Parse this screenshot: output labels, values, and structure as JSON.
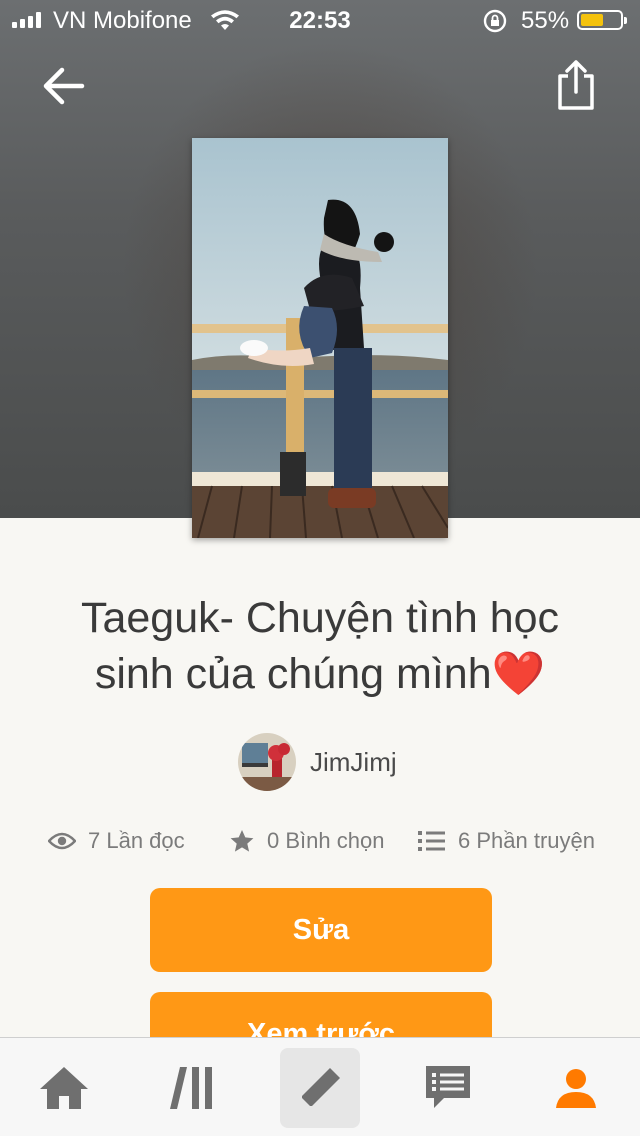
{
  "status_bar": {
    "carrier": "VN Mobifone",
    "time": "22:53",
    "battery_percent": "55%",
    "battery_level": 0.55,
    "battery_color": "#f4c20d"
  },
  "story": {
    "title": "Taeguk- Chuyện tình học sinh của chúng mình",
    "title_emoji": "❤️",
    "author": "JimJimj",
    "reads": "7 Lần đọc",
    "votes": "0 Bình chọn",
    "parts": "6 Phần truyện"
  },
  "actions": {
    "edit_label": "Sửa",
    "preview_label": "Xem trước"
  },
  "tab_bar": {
    "items": [
      {
        "icon": "home-icon"
      },
      {
        "icon": "library-icon"
      },
      {
        "icon": "write-pencil-icon"
      },
      {
        "icon": "messages-icon"
      },
      {
        "icon": "profile-icon"
      }
    ],
    "active_color": "#ff7a00",
    "inactive_color": "#6f6f6f"
  },
  "colors": {
    "accent": "#ff9815",
    "background": "#f8f7f3"
  }
}
